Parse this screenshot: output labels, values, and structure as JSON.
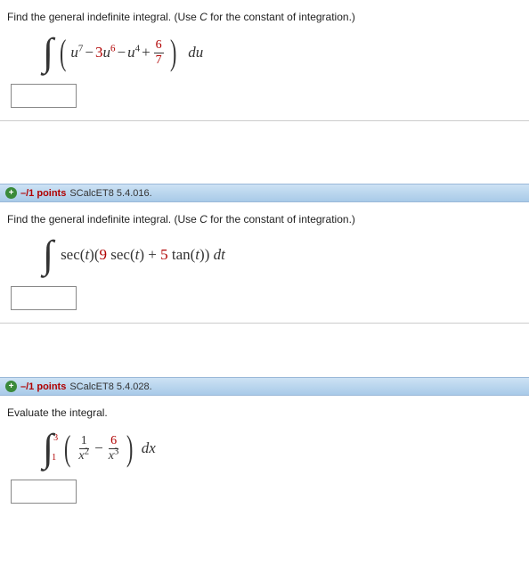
{
  "q1": {
    "prompt_a": "Find the general indefinite integral. (Use ",
    "prompt_c": "C",
    "prompt_b": " for the constant of integration.)",
    "u7": "u",
    "e7": "7",
    "minus1": " − ",
    "c3": "3",
    "u6": "u",
    "e6": "6",
    "minus2": " − ",
    "u4": "u",
    "e4": "4",
    "plus": " + ",
    "frac_num": "6",
    "frac_den": "7",
    "du": "du"
  },
  "q2": {
    "header_points": "–/1 points",
    "header_source": "SCalcET8 5.4.016.",
    "prompt_a": "Find the general indefinite integral. (Use ",
    "prompt_c": "C",
    "prompt_b": " for the constant of integration.)",
    "p1": "sec(",
    "t1": "t",
    "p2": ")(",
    "nine": "9",
    "p3": " sec(",
    "t2": "t",
    "p4": ") + ",
    "five": "5",
    "p5": " tan(",
    "t3": "t",
    "p6": ")) ",
    "dt": "dt"
  },
  "q3": {
    "header_points": "–/1 points",
    "header_source": "SCalcET8 5.4.028.",
    "prompt": "Evaluate the integral.",
    "ub": "3",
    "lb": "1",
    "f1n": "1",
    "f1d_base": "x",
    "f1d_exp": "2",
    "minus": " − ",
    "f2n": "6",
    "f2d_base": "x",
    "f2d_exp": "3",
    "dx": "dx"
  }
}
